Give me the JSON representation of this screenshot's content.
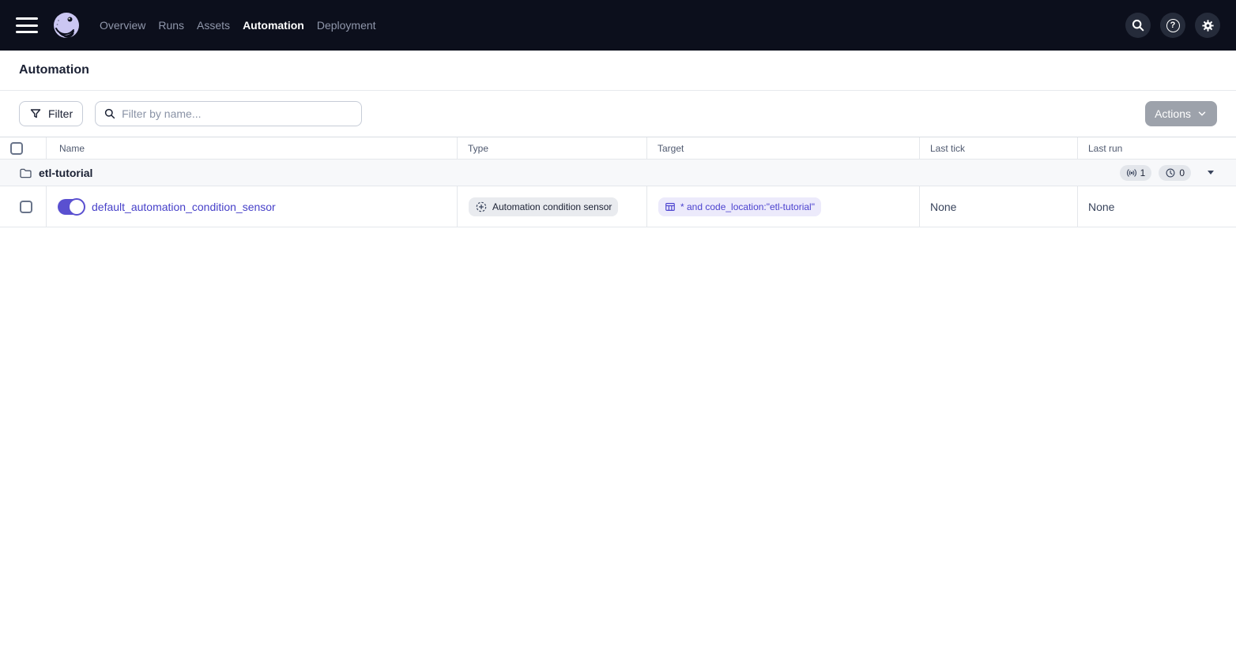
{
  "nav": {
    "items": [
      "Overview",
      "Runs",
      "Assets",
      "Automation",
      "Deployment"
    ],
    "active_item": "Automation"
  },
  "page": {
    "title": "Automation"
  },
  "toolbar": {
    "filter_button_label": "Filter",
    "search_placeholder": "Filter by name...",
    "actions_button_label": "Actions"
  },
  "table": {
    "columns": [
      "Name",
      "Type",
      "Target",
      "Last tick",
      "Last run"
    ],
    "group": {
      "name": "etl-tutorial",
      "sensor_count": "1",
      "schedule_count": "0"
    },
    "rows": [
      {
        "name": "default_automation_condition_sensor",
        "enabled": true,
        "type": "Automation condition sensor",
        "target": "* and code_location:\"etl-tutorial\"",
        "last_tick": "None",
        "last_run": "None"
      }
    ]
  },
  "icons": {
    "menu": "hamburger",
    "logo": "dagster-octopus",
    "search": "magnifier",
    "help": "question-circle",
    "help_glyph": "?",
    "settings": "gear",
    "filter": "funnel",
    "search_field": "magnifier",
    "group": "folder",
    "sensor_count": "broadcast",
    "schedule_count": "clock",
    "type_badge": "automation-condition",
    "target_badge": "asset-table",
    "actions_caret": "chevron-down",
    "group_caret": "caret-down"
  },
  "colors": {
    "nav_bg": "#0C0F1C",
    "accent_link": "#4741C9",
    "toggle_on": "#5A50D0",
    "type_badge_bg": "#E9EBEF",
    "target_badge_bg": "#ECEAFB",
    "group_row_bg": "#F7F8FA",
    "border": "#E4E7EB",
    "actions_disabled_bg": "#9DA2AB"
  }
}
